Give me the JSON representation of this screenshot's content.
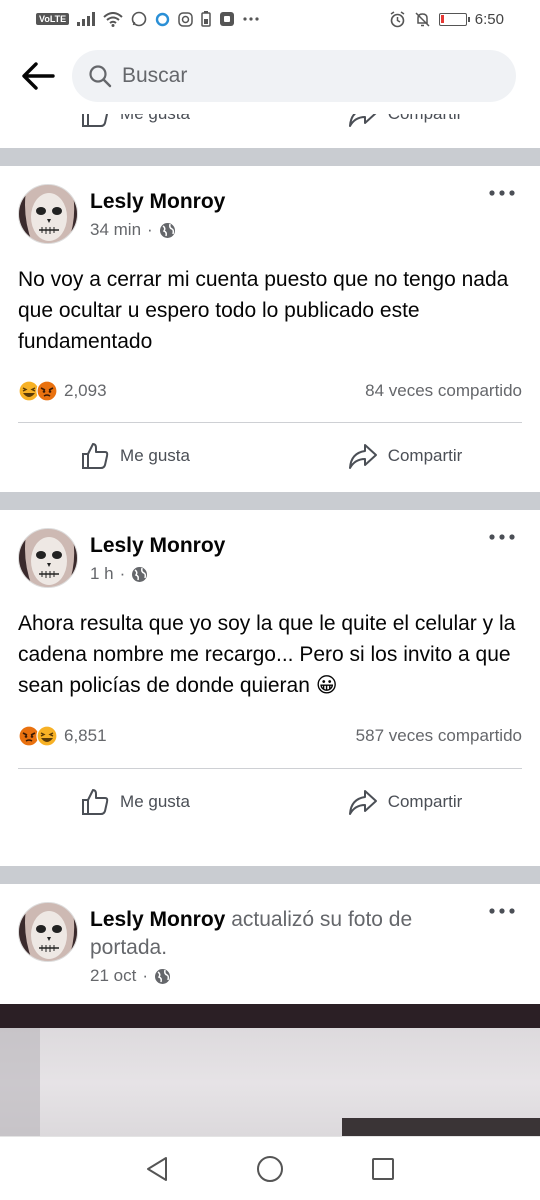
{
  "status_bar": {
    "volte": "VoLTE",
    "time": "6:50",
    "battery_level": 0.12
  },
  "search": {
    "placeholder": "Buscar"
  },
  "previous_post": {
    "like_label": "Me gusta",
    "share_label": "Compartir"
  },
  "posts": [
    {
      "author": "Lesly Monroy",
      "time": "34 min",
      "text": "No voy a cerrar mi cuenta puesto que no tengo nada que ocultar u espero todo lo publicado este fundamentado",
      "reactions": [
        "haha",
        "angry"
      ],
      "reaction_count": "2,093",
      "shares": "84 veces compartido",
      "like_label": "Me gusta",
      "share_label": "Compartir"
    },
    {
      "author": "Lesly Monroy",
      "time": "1 h",
      "text": "Ahora resulta que yo soy la que le quite el celular y la cadena nombre me recargo... Pero si los invito a que sean policías de donde quieran 😀",
      "reactions": [
        "angry",
        "haha"
      ],
      "reaction_count": "6,851",
      "shares": "587 veces compartido",
      "like_label": "Me gusta",
      "share_label": "Compartir"
    },
    {
      "author": "Lesly Monroy",
      "action": " actualizó su foto de portada.",
      "time": "21 oct"
    }
  ],
  "colors": {
    "feed_gap": "#c9ccd1",
    "reaction_haha": "#f7b125",
    "reaction_angry": "#e9710f",
    "text_secondary": "#65676b"
  }
}
